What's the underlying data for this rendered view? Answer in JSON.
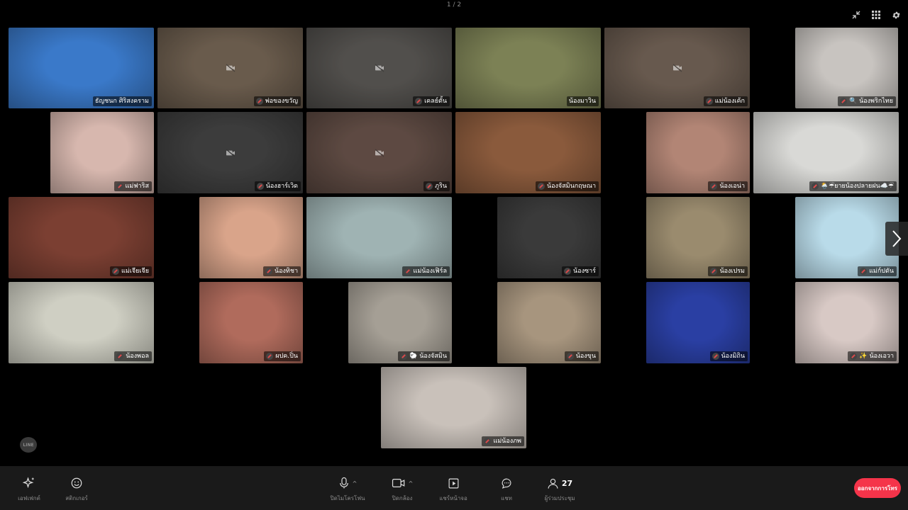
{
  "pager": "1 / 2",
  "participants": [
    {
      "name": "ธัญชนก ศิริสงคราม",
      "mic_off": false,
      "cam_off": false,
      "color": "#3a79c9"
    },
    {
      "name": "พ่อของขวัญ",
      "mic_off": true,
      "cam_off": true,
      "color": "#8d7a66"
    },
    {
      "name": "เคลย์ตั้น",
      "mic_off": true,
      "cam_off": true,
      "color": "#6d6a66"
    },
    {
      "name": "น้องมาวิน",
      "mic_off": false,
      "cam_off": false,
      "color": "#7c8155"
    },
    {
      "name": "แม่น้องเค้ก",
      "mic_off": true,
      "cam_off": true,
      "color": "#8a7768"
    },
    {
      "name": "🔍 น้องพริกไทย",
      "mic_off": true,
      "cam_off": false,
      "color": "#c8c4c0"
    },
    {
      "name": "แม่ฟาริส",
      "mic_off": true,
      "cam_off": false,
      "color": "#d7b7ae"
    },
    {
      "name": "น้องฮาร์เวิด",
      "mic_off": true,
      "cam_off": true,
      "color": "#505050"
    },
    {
      "name": "ภูริน",
      "mic_off": true,
      "cam_off": true,
      "color": "#7c6258"
    },
    {
      "name": "น้องจัสมินกฤษณา",
      "mic_off": true,
      "cam_off": false,
      "color": "#8a5a3c"
    },
    {
      "name": "น้องเอน่า",
      "mic_off": true,
      "cam_off": false,
      "color": "#b28575"
    },
    {
      "name": "🌦️☔ยายน้องปลายฝน☁️☔",
      "mic_off": true,
      "cam_off": false,
      "color": "#d9d9d6"
    },
    {
      "name": "แม่เจียเจีย",
      "mic_off": true,
      "cam_off": false,
      "color": "#7b3f32"
    },
    {
      "name": "น้องทิชา",
      "mic_off": true,
      "cam_off": false,
      "color": "#d9a48a"
    },
    {
      "name": "แม่น้องเฟิร์ล",
      "mic_off": true,
      "cam_off": false,
      "color": "#9fb3b3"
    },
    {
      "name": "น้องซาร์",
      "mic_off": true,
      "cam_off": false,
      "color": "#3a3a3a"
    },
    {
      "name": "น้องเปรม",
      "mic_off": true,
      "cam_off": false,
      "color": "#9a8b6e"
    },
    {
      "name": "แม่ก์ปตัน",
      "mic_off": true,
      "cam_off": false,
      "color": "#b9dbe9"
    },
    {
      "name": "น้องพอล",
      "mic_off": true,
      "cam_off": false,
      "color": "#cfcfc3"
    },
    {
      "name": "ผปค.ปิ่น",
      "mic_off": true,
      "cam_off": false,
      "color": "#b06b5c"
    },
    {
      "name": "🐑 น้องจัสมิน",
      "mic_off": true,
      "cam_off": false,
      "color": "#a59f95"
    },
    {
      "name": "น้องขุน",
      "mic_off": true,
      "cam_off": false,
      "color": "#a7957e"
    },
    {
      "name": "น้องมิถิน",
      "mic_off": true,
      "cam_off": false,
      "color": "#2a3fa3"
    },
    {
      "name": "✨ น้องเอวา",
      "mic_off": true,
      "cam_off": false,
      "color": "#d8c9c5"
    },
    {
      "name": "แม่น้องภพ",
      "mic_off": true,
      "cam_off": false,
      "color": "#c9c1ba"
    }
  ],
  "toolbar": {
    "effects": "เอฟเฟกต์",
    "stickers": "สติกเกอร์",
    "mic": "ปิดไมโครโฟน",
    "camera": "ปิดกล้อง",
    "share": "แชร์หน้าจอ",
    "chat": "แชท",
    "participants": "ผู้ร่วมประชุม",
    "participant_count": "27",
    "leave": "ออกจากการโทร"
  },
  "logo": "LINE"
}
